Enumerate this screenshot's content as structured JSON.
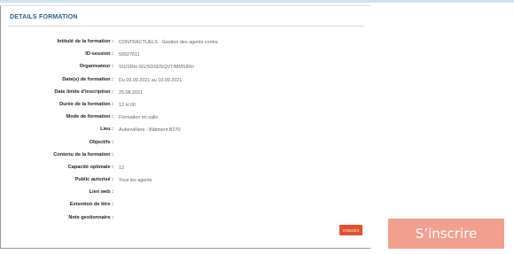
{
  "header": {
    "title": "DETAILS FORMATION"
  },
  "fields": [
    {
      "label": "Intitulé de la formation :",
      "value": "CONTRACTUELS - Gestion des agents contra"
    },
    {
      "label": "ID-session :",
      "value": "50927611"
    },
    {
      "label": "Organisateur :",
      "value": "SG/SRH-SG/SDSDSQVT/MMSIRH"
    },
    {
      "label": "Date(s) de formation :",
      "value": "Du 09.09.2021 au 10.09.2021"
    },
    {
      "label": "Date limite d'inscription :",
      "value": "25.08.2021"
    },
    {
      "label": "Durée de la formation :",
      "value": "12 H 00"
    },
    {
      "label": "Mode de formation :",
      "value": "Formation en salle"
    },
    {
      "label": "Lieu :",
      "value": "Aubervilliers - Bâtiment B270"
    },
    {
      "label": "Objectifs :",
      "value": ""
    },
    {
      "label": "Contenu de la formation :",
      "value": ""
    },
    {
      "label": "Capacité optimale :",
      "value": "12"
    },
    {
      "label": "Public autorisé :",
      "value": "Tous les agents"
    },
    {
      "label": "Lien web :",
      "value": ""
    },
    {
      "label": "Extention de titre :",
      "value": ""
    },
    {
      "label": "Note gestionnaire :",
      "value": ""
    }
  ],
  "actions": {
    "small_register_label": "S'inscrire",
    "big_register_label": "S’inscrire"
  },
  "colors": {
    "title": "#2b5d87",
    "button": "#e0522b",
    "callout": "#f29f8f"
  }
}
